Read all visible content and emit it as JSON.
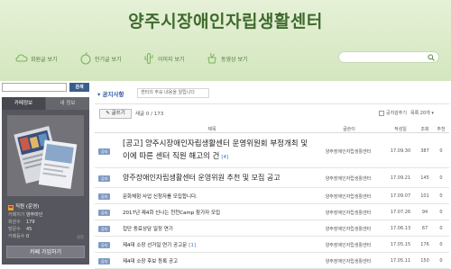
{
  "banner": {
    "title": "양주시장애인자립생활센터",
    "nav": [
      {
        "label": "회원글 보기",
        "icon": "cloud-icon",
        "color": "#7ab55c"
      },
      {
        "label": "인기글 보기",
        "icon": "apple-icon",
        "color": "#7ab55c"
      },
      {
        "label": "이미지 보기",
        "icon": "cactus-icon",
        "color": "#7ab55c"
      },
      {
        "label": "동영상 보기",
        "icon": "pot-icon",
        "color": "#7ab55c"
      }
    ],
    "search_icon": "search-icon"
  },
  "sidebar": {
    "search_button": "검색",
    "tabs": {
      "cafe_info": "카페정보",
      "my_info": "내 정보"
    },
    "grade": "직원 (운영)",
    "stats": [
      {
        "label": "카페지기",
        "value": "양주마인"
      },
      {
        "label": "회원수",
        "value": "179"
      },
      {
        "label": "방문수",
        "value": "45"
      },
      {
        "label": "카페등수",
        "value": "0"
      }
    ],
    "settings_link": "설정",
    "join_button": "카페 가입하기"
  },
  "board": {
    "title": "공지사항",
    "description": "센터의 주요 내용을 알립니다",
    "write_button": "글쓰기",
    "post_count": "새글 0 / 173",
    "notice_toggle": "공지감추기",
    "per_page": "목록 20개",
    "headers": {
      "title": "제목",
      "author": "글쓴이",
      "date": "작성일",
      "views": "조회",
      "likes": "추천"
    }
  },
  "posts": [
    {
      "badge": "공지",
      "title": "[공고] 양주시장애인자립생활센터 운영위원회 부정개최 및 이에 따른 센터 직원 해고의 건",
      "comments": "[4]",
      "author": "양주장애인자립생활센터",
      "date": "17.09.30",
      "views": "387",
      "likes": "0",
      "size": "big"
    },
    {
      "badge": "공지",
      "title": "양주장애인자립생활센터 운영위원 추천 및 모집 공고",
      "comments": "",
      "author": "양주장애인자립생활센터",
      "date": "17.09.21",
      "views": "145",
      "likes": "0",
      "size": "mid"
    },
    {
      "badge": "공지",
      "title": "문화체험 사업 신청자를 모집합니다.",
      "comments": "",
      "author": "양주장애인자립생활센터",
      "date": "17.09.07",
      "views": "101",
      "likes": "0",
      "size": "small"
    },
    {
      "badge": "공지",
      "title": "2017년 제4회 신나는 천천Camp 참가자 모집",
      "comments": "",
      "author": "양주장애인자립생활센터",
      "date": "17.07.26",
      "views": "94",
      "likes": "0",
      "size": "small"
    },
    {
      "badge": "공지",
      "title": "집단 동료상담 일정 연기",
      "comments": "",
      "author": "양주장애인자립생활센터",
      "date": "17.06.13",
      "views": "67",
      "likes": "0",
      "size": "small"
    },
    {
      "badge": "공지",
      "title": "제4대 소장 선거일 연기 공고문",
      "comments": "[1]",
      "author": "양주장애인자립생활센터",
      "date": "17.05.15",
      "views": "176",
      "likes": "0",
      "size": "small"
    },
    {
      "badge": "공지",
      "title": "제4대 소장 후보 등록 공고",
      "comments": "",
      "author": "양주장애인자립생활센터",
      "date": "17.05.11",
      "views": "150",
      "likes": "0",
      "size": "small"
    }
  ]
}
